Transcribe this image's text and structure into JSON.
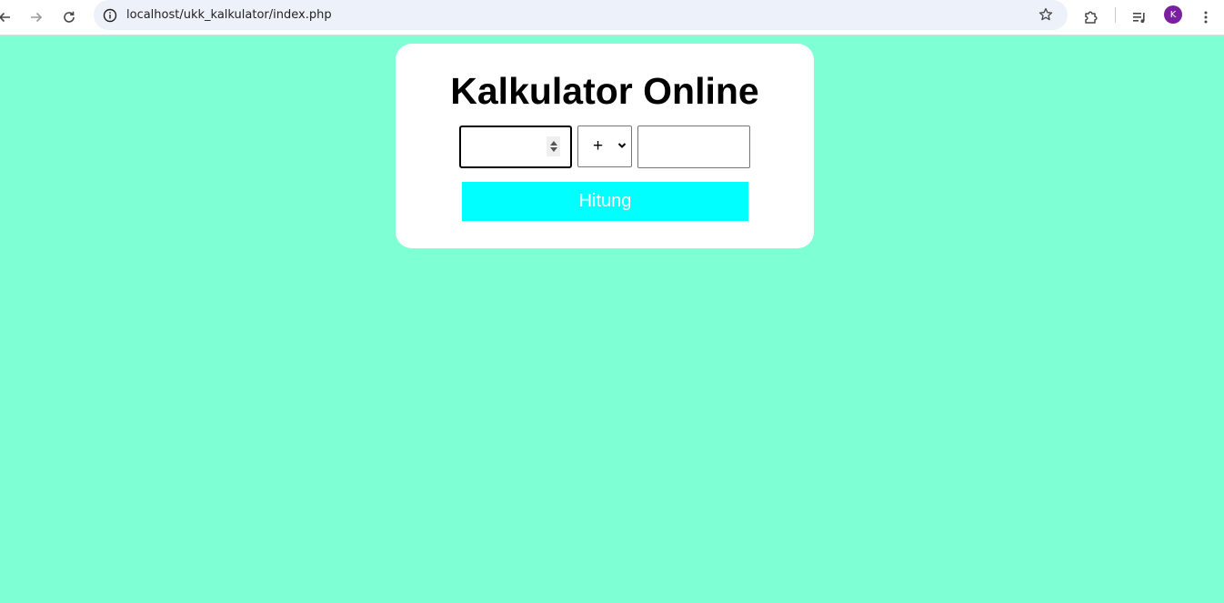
{
  "browser": {
    "url": "localhost/ukk_kalkulator/index.php",
    "profile_initial": "K",
    "icons": {
      "back": "arrow-left-icon",
      "forward": "arrow-right-icon",
      "reload": "reload-icon",
      "site_info": "info-icon",
      "bookmark": "star-icon",
      "extensions": "puzzle-icon",
      "media": "media-queue-icon",
      "menu": "kebab-menu-icon"
    },
    "colors": {
      "avatar": "#7b1fa2",
      "address_bar": "#edf1f9"
    }
  },
  "page": {
    "title": "Kalkulator Online",
    "first_number": {
      "value": "",
      "placeholder": ""
    },
    "operator": {
      "selected": "+"
    },
    "second_number": {
      "value": "",
      "placeholder": ""
    },
    "submit_label": "Hitung",
    "colors": {
      "background": "#7fffd4",
      "card": "#ffffff",
      "button": "#00ffff",
      "button_text": "#ffffff"
    }
  }
}
